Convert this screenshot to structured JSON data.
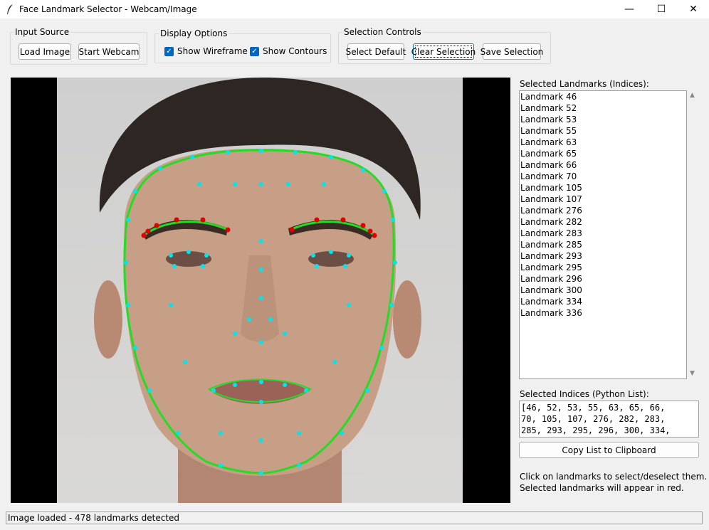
{
  "window": {
    "title": "Face Landmark Selector - Webcam/Image",
    "minimize_glyph": "—",
    "maximize_glyph": "☐",
    "close_glyph": "✕"
  },
  "input_source": {
    "label": "Input Source",
    "load_image": "Load Image",
    "start_webcam": "Start Webcam"
  },
  "display_options": {
    "label": "Display Options",
    "show_wireframe": "Show Wireframe",
    "show_wireframe_checked": true,
    "show_contours": "Show Contours",
    "show_contours_checked": true
  },
  "selection_controls": {
    "label": "Selection Controls",
    "select_default": "Select Default",
    "clear_selection": "Clear Selection",
    "save_selection": "Save Selection"
  },
  "selected_panel": {
    "title": "Selected Landmarks (Indices):",
    "items": [
      "Landmark 46",
      "Landmark 52",
      "Landmark 53",
      "Landmark 55",
      "Landmark 63",
      "Landmark 65",
      "Landmark 66",
      "Landmark 70",
      "Landmark 105",
      "Landmark 107",
      "Landmark 276",
      "Landmark 282",
      "Landmark 283",
      "Landmark 285",
      "Landmark 293",
      "Landmark 295",
      "Landmark 296",
      "Landmark 300",
      "Landmark 334",
      "Landmark 336"
    ]
  },
  "python_list": {
    "title": "Selected Indices (Python List):",
    "lines": [
      "[46, 52, 53, 55, 63, 65, 66,",
      "70, 105, 107, 276, 282, 283,",
      "285, 293, 295, 296, 300, 334,"
    ]
  },
  "copy_button": "Copy List to Clipboard",
  "help": {
    "line1": "Click on landmarks to select/deselect them.",
    "line2": "Selected landmarks will appear in red."
  },
  "status": "Image loaded - 478 landmarks detected",
  "colors": {
    "landmark": "#00e5ee",
    "selected_landmark": "#e00000",
    "contour": "#22dd22",
    "wireframe": "#5fd6d6"
  },
  "icons": {
    "app_icon": "feather-icon",
    "scroll_up": "▲",
    "scroll_down": "▼",
    "checkbox": "✓"
  }
}
